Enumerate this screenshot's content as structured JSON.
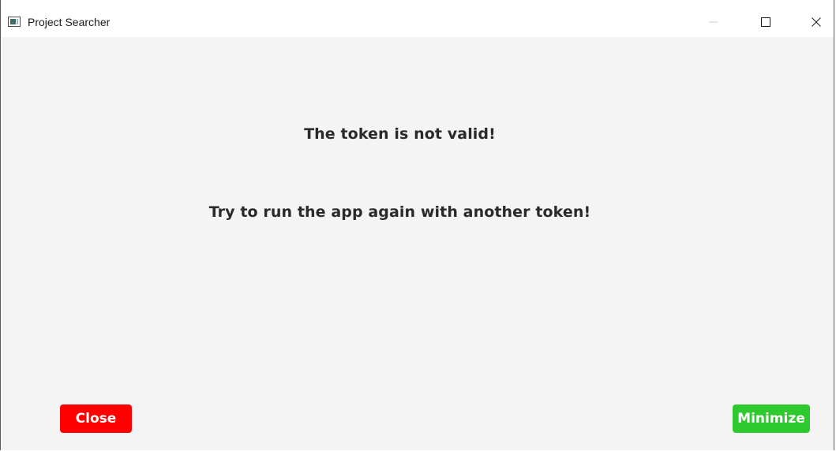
{
  "window": {
    "title": "Project Searcher"
  },
  "titlebar_controls": {
    "minimize_icon": "minimize-icon",
    "maximize_icon": "maximize-icon",
    "close_icon": "close-icon"
  },
  "content": {
    "message_primary": "The token is not valid!",
    "message_secondary": "Try to run the app again with another token!"
  },
  "buttons": {
    "close_label": "Close",
    "minimize_label": "Minimize"
  },
  "colors": {
    "close_button": "#ff0000",
    "minimize_button": "#2ec92e",
    "background": "#f4f4f4"
  }
}
